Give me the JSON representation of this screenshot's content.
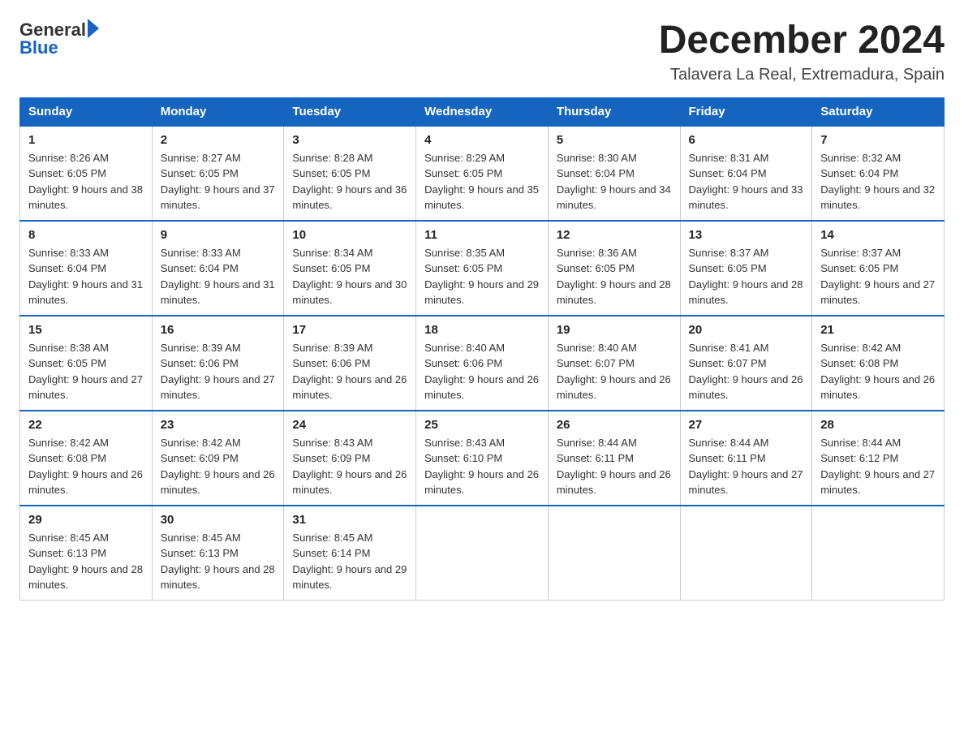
{
  "header": {
    "title": "December 2024",
    "subtitle": "Talavera La Real, Extremadura, Spain"
  },
  "logo": {
    "general": "General",
    "blue": "Blue"
  },
  "days": [
    "Sunday",
    "Monday",
    "Tuesday",
    "Wednesday",
    "Thursday",
    "Friday",
    "Saturday"
  ],
  "weeks": [
    [
      {
        "day": "1",
        "sunrise": "8:26 AM",
        "sunset": "6:05 PM",
        "daylight": "9 hours and 38 minutes."
      },
      {
        "day": "2",
        "sunrise": "8:27 AM",
        "sunset": "6:05 PM",
        "daylight": "9 hours and 37 minutes."
      },
      {
        "day": "3",
        "sunrise": "8:28 AM",
        "sunset": "6:05 PM",
        "daylight": "9 hours and 36 minutes."
      },
      {
        "day": "4",
        "sunrise": "8:29 AM",
        "sunset": "6:05 PM",
        "daylight": "9 hours and 35 minutes."
      },
      {
        "day": "5",
        "sunrise": "8:30 AM",
        "sunset": "6:04 PM",
        "daylight": "9 hours and 34 minutes."
      },
      {
        "day": "6",
        "sunrise": "8:31 AM",
        "sunset": "6:04 PM",
        "daylight": "9 hours and 33 minutes."
      },
      {
        "day": "7",
        "sunrise": "8:32 AM",
        "sunset": "6:04 PM",
        "daylight": "9 hours and 32 minutes."
      }
    ],
    [
      {
        "day": "8",
        "sunrise": "8:33 AM",
        "sunset": "6:04 PM",
        "daylight": "9 hours and 31 minutes."
      },
      {
        "day": "9",
        "sunrise": "8:33 AM",
        "sunset": "6:04 PM",
        "daylight": "9 hours and 31 minutes."
      },
      {
        "day": "10",
        "sunrise": "8:34 AM",
        "sunset": "6:05 PM",
        "daylight": "9 hours and 30 minutes."
      },
      {
        "day": "11",
        "sunrise": "8:35 AM",
        "sunset": "6:05 PM",
        "daylight": "9 hours and 29 minutes."
      },
      {
        "day": "12",
        "sunrise": "8:36 AM",
        "sunset": "6:05 PM",
        "daylight": "9 hours and 28 minutes."
      },
      {
        "day": "13",
        "sunrise": "8:37 AM",
        "sunset": "6:05 PM",
        "daylight": "9 hours and 28 minutes."
      },
      {
        "day": "14",
        "sunrise": "8:37 AM",
        "sunset": "6:05 PM",
        "daylight": "9 hours and 27 minutes."
      }
    ],
    [
      {
        "day": "15",
        "sunrise": "8:38 AM",
        "sunset": "6:05 PM",
        "daylight": "9 hours and 27 minutes."
      },
      {
        "day": "16",
        "sunrise": "8:39 AM",
        "sunset": "6:06 PM",
        "daylight": "9 hours and 27 minutes."
      },
      {
        "day": "17",
        "sunrise": "8:39 AM",
        "sunset": "6:06 PM",
        "daylight": "9 hours and 26 minutes."
      },
      {
        "day": "18",
        "sunrise": "8:40 AM",
        "sunset": "6:06 PM",
        "daylight": "9 hours and 26 minutes."
      },
      {
        "day": "19",
        "sunrise": "8:40 AM",
        "sunset": "6:07 PM",
        "daylight": "9 hours and 26 minutes."
      },
      {
        "day": "20",
        "sunrise": "8:41 AM",
        "sunset": "6:07 PM",
        "daylight": "9 hours and 26 minutes."
      },
      {
        "day": "21",
        "sunrise": "8:42 AM",
        "sunset": "6:08 PM",
        "daylight": "9 hours and 26 minutes."
      }
    ],
    [
      {
        "day": "22",
        "sunrise": "8:42 AM",
        "sunset": "6:08 PM",
        "daylight": "9 hours and 26 minutes."
      },
      {
        "day": "23",
        "sunrise": "8:42 AM",
        "sunset": "6:09 PM",
        "daylight": "9 hours and 26 minutes."
      },
      {
        "day": "24",
        "sunrise": "8:43 AM",
        "sunset": "6:09 PM",
        "daylight": "9 hours and 26 minutes."
      },
      {
        "day": "25",
        "sunrise": "8:43 AM",
        "sunset": "6:10 PM",
        "daylight": "9 hours and 26 minutes."
      },
      {
        "day": "26",
        "sunrise": "8:44 AM",
        "sunset": "6:11 PM",
        "daylight": "9 hours and 26 minutes."
      },
      {
        "day": "27",
        "sunrise": "8:44 AM",
        "sunset": "6:11 PM",
        "daylight": "9 hours and 27 minutes."
      },
      {
        "day": "28",
        "sunrise": "8:44 AM",
        "sunset": "6:12 PM",
        "daylight": "9 hours and 27 minutes."
      }
    ],
    [
      {
        "day": "29",
        "sunrise": "8:45 AM",
        "sunset": "6:13 PM",
        "daylight": "9 hours and 28 minutes."
      },
      {
        "day": "30",
        "sunrise": "8:45 AM",
        "sunset": "6:13 PM",
        "daylight": "9 hours and 28 minutes."
      },
      {
        "day": "31",
        "sunrise": "8:45 AM",
        "sunset": "6:14 PM",
        "daylight": "9 hours and 29 minutes."
      },
      null,
      null,
      null,
      null
    ]
  ]
}
